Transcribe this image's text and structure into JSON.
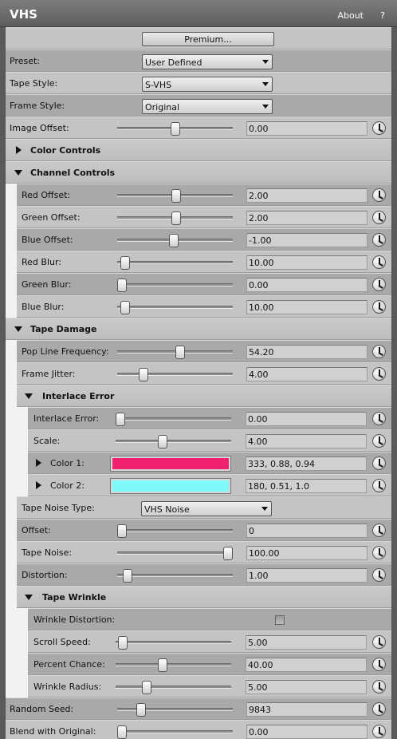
{
  "window": {
    "title": "VHS",
    "about_label": "About",
    "help_label": "?"
  },
  "premium_label": "Premium...",
  "preset": {
    "label": "Preset:",
    "value": "User Defined"
  },
  "tape_style": {
    "label": "Tape Style:",
    "value": "S-VHS"
  },
  "frame_style": {
    "label": "Frame Style:",
    "value": "Original"
  },
  "image_offset": {
    "label": "Image Offset:",
    "value": "0.00",
    "slider": 0.5
  },
  "color_controls": {
    "label": "Color Controls"
  },
  "channel_controls": {
    "label": "Channel Controls",
    "red_offset": {
      "label": "Red Offset:",
      "value": "2.00",
      "slider": 0.51
    },
    "green_offset": {
      "label": "Green Offset:",
      "value": "2.00",
      "slider": 0.51
    },
    "blue_offset": {
      "label": "Blue Offset:",
      "value": "-1.00",
      "slider": 0.49
    },
    "red_blur": {
      "label": "Red Blur:",
      "value": "10.00",
      "slider": 0.03
    },
    "green_blur": {
      "label": "Green Blur:",
      "value": "0.00",
      "slider": 0.0
    },
    "blue_blur": {
      "label": "Blue Blur:",
      "value": "10.00",
      "slider": 0.03
    }
  },
  "tape_damage": {
    "label": "Tape Damage",
    "pop_line_frequency": {
      "label": "Pop Line Frequency:",
      "value": "54.20",
      "slider": 0.55
    },
    "frame_jitter": {
      "label": "Frame Jitter:",
      "value": "4.00",
      "slider": 0.2
    },
    "interlace_error": {
      "label": "Interlace Error",
      "amount": {
        "label": "Interlace Error:",
        "value": "0.00",
        "slider": 0.0
      },
      "scale": {
        "label": "Scale:",
        "value": "4.00",
        "slider": 0.4
      },
      "color1": {
        "label": "Color 1:",
        "value": "333, 0.88, 0.94",
        "color": "#f0226f"
      },
      "color2": {
        "label": "Color 2:",
        "value": "180, 0.51, 1.0",
        "color": "#7ffafa"
      }
    },
    "tape_noise_type": {
      "label": "Tape Noise Type:",
      "value": "VHS Noise"
    },
    "offset": {
      "label": "Offset:",
      "value": "0",
      "slider": 0.0
    },
    "tape_noise": {
      "label": "Tape Noise:",
      "value": "100.00",
      "slider": 1.0
    },
    "distortion": {
      "label": "Distortion:",
      "value": "1.00",
      "slider": 0.05
    },
    "tape_wrinkle": {
      "label": "Tape Wrinkle",
      "wrinkle_distortion": {
        "label": "Wrinkle Distortion:",
        "checked": false
      },
      "scroll_speed": {
        "label": "Scroll Speed:",
        "value": "5.00",
        "slider": 0.02
      },
      "percent_chance": {
        "label": "Percent Chance:",
        "value": "40.00",
        "slider": 0.4
      },
      "wrinkle_radius": {
        "label": "Wrinkle Radius:",
        "value": "5.00",
        "slider": 0.25
      }
    }
  },
  "random_seed": {
    "label": "Random Seed:",
    "value": "9843",
    "slider": 0.18
  },
  "blend_with_original": {
    "label": "Blend with Original:",
    "value": "0.00",
    "slider": 0.0
  }
}
